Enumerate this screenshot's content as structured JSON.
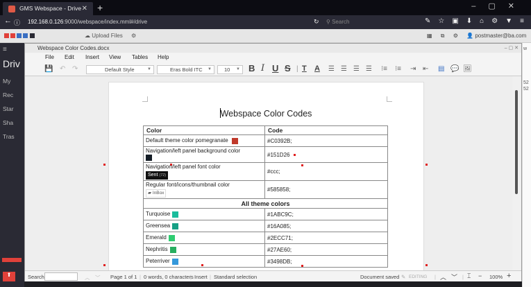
{
  "browser": {
    "tab_title": "GMS Webspace - Drive",
    "url_host": "192.168.0.126",
    "url_rest": ":9000/webspace/index.mml#/drive",
    "search_placeholder": "Search"
  },
  "app": {
    "upload_label": "Upload Files",
    "user_email": "postmaster@ba.com",
    "sidebar_title": "Driv",
    "sidebar_items": [
      "My",
      "Rec",
      "Star",
      "Sha",
      "Tras"
    ],
    "right_fragments": [
      "52",
      "52",
      "w"
    ],
    "colors": {
      "red": "#e0413a",
      "green": "#4ab04e",
      "blue": "#3a6fc2",
      "dark": "#2a2a34"
    }
  },
  "dialog": {
    "title": "Webspace Color Codes.docx",
    "menu": [
      "File",
      "Edit",
      "Insert",
      "View",
      "Tables",
      "Help"
    ],
    "toolbar": {
      "style": "Default Style",
      "font": "Eras Bold ITC",
      "size": "10"
    }
  },
  "document": {
    "title": "Webspace Color Codes",
    "headers": [
      "Color",
      "Code"
    ],
    "rows": [
      {
        "name": "Default theme color pomegranate",
        "code": "#C0392B;",
        "swatch": "#c0392b"
      },
      {
        "name": "Navigation/left panel background color",
        "code": "#151D26",
        "swatch": "#151d26"
      },
      {
        "name": "Navigation/left panel font color",
        "code": "#ccc;",
        "badge": "Sent",
        "badge_count": "(72)"
      },
      {
        "name": "Regular font/icons/thumbnail color",
        "code": "#585858;",
        "sub": "InBox"
      }
    ],
    "section": "All theme colors",
    "theme_rows": [
      {
        "name": "Turquoise",
        "code": "#1ABC9C;",
        "swatch": "#1abc9c"
      },
      {
        "name": "Greensea",
        "code": "#16A085;",
        "swatch": "#16a085"
      },
      {
        "name": "Emerald",
        "code": "#2ECC71;",
        "swatch": "#2ecc71"
      },
      {
        "name": "Nephritis",
        "code": "#27AE60;",
        "swatch": "#27ae60"
      },
      {
        "name": "Peterriver",
        "code": "#3498DB;",
        "swatch": "#3498db"
      }
    ]
  },
  "status": {
    "search_label": "Search:",
    "page": "Page 1 of 1",
    "counts": "0 words, 0 characters",
    "mode": "Insert",
    "selection": "Standard selection",
    "saved": "Document saved",
    "editing": "EDITING",
    "zoom": "100%"
  }
}
